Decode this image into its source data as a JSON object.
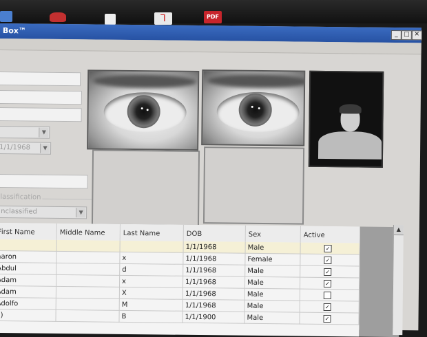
{
  "window": {
    "title": "Box™"
  },
  "taskbar": {
    "pdf_label": "PDF",
    "acrobat_glyph": "⅂"
  },
  "form": {
    "dob_value": "1/1/1968",
    "classification_label": "lassification",
    "classification_value": "nclassified"
  },
  "table": {
    "columns": [
      "First Name",
      "Middle Name",
      "Last Name",
      "DOB",
      "Sex",
      "Active"
    ],
    "rows": [
      [
        "",
        "",
        "",
        "1/1/1968",
        "Male",
        true
      ],
      [
        "aaron",
        "",
        "x",
        "1/1/1968",
        "Female",
        true
      ],
      [
        "Abdul",
        "",
        "d",
        "1/1/1968",
        "Male",
        true
      ],
      [
        "Adam",
        "",
        "x",
        "1/1/1968",
        "Male",
        true
      ],
      [
        "Adam",
        "",
        "X",
        "1/1/1968",
        "Male",
        false
      ],
      [
        "Adolfo",
        "",
        "M",
        "1/1/1968",
        "Male",
        true
      ],
      [
        "a)",
        "",
        "B",
        "1/1/1900",
        "Male",
        true
      ]
    ]
  },
  "colors": {
    "titlebar": "#2752a3",
    "selected_row": "#f5f0d6"
  }
}
